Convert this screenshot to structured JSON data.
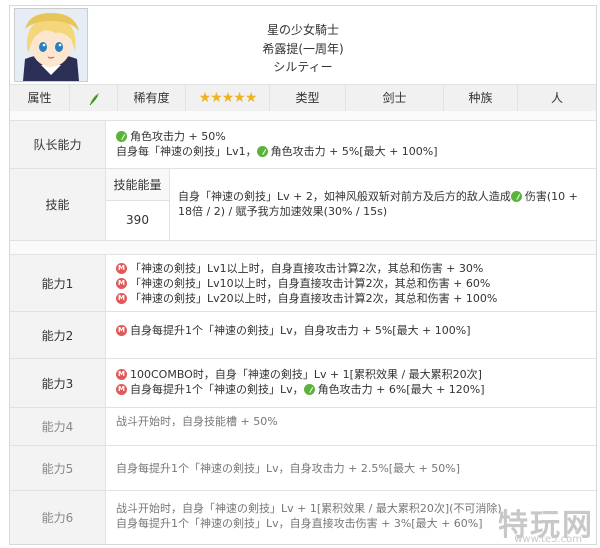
{
  "header": {
    "name_line1": "星の少女騎士",
    "name_line2": "希露提(一周年)",
    "name_line3": "シルティー"
  },
  "attributes": {
    "attr_label": "属性",
    "rarity_label": "稀有度",
    "rarity_stars": "★★★★★",
    "type_label": "类型",
    "type_value": "剑士",
    "race_label": "种族",
    "race_value": "人"
  },
  "leader": {
    "label": "队长能力",
    "line1": "角色攻击力 + 50%",
    "line2_pre": "自身每「神速の剣技」Lv1，",
    "line2_post": "角色攻击力 + 5%[最大 + 100%]"
  },
  "skill": {
    "label": "技能",
    "energy_label": "技能能量",
    "energy_value": "390",
    "desc_line1_pre": "自身「神速の剣技」Lv + 2，如神风般双斩对前方及后方的敌人造成",
    "desc_line1_post": "伤害(10 +",
    "desc_line2": "18倍 / 2) / 赋予我方加速效果(30% / 15s)"
  },
  "abilities": [
    {
      "label": "能力1",
      "lines": [
        "「神速の剣技」Lv1以上时，自身直接攻击计算2次，其总和伤害 + 30%",
        "「神速の剣技」Lv10以上时，自身直接攻击计算2次，其总和伤害 + 60%",
        "「神速の剣技」Lv20以上时，自身直接攻击计算2次，其总和伤害 + 100%"
      ]
    },
    {
      "label": "能力2",
      "lines": [
        "自身每提升1个「神速の剣技」Lv，自身攻击力 + 5%[最大 + 100%]"
      ]
    },
    {
      "label": "能力3",
      "line1": "100COMBO时，自身「神速の剣技」Lv + 1[累积效果 / 最大累积20次]",
      "line2_pre": "自身每提升1个「神速の剣技」Lv，",
      "line2_post": "角色攻击力 + 6%[最大 + 120%]"
    },
    {
      "label": "能力4",
      "line1": "战斗开始时，自身技能槽 + 50%"
    },
    {
      "label": "能力5",
      "line1": "自身每提升1个「神速の剣技」Lv，自身攻击力 + 2.5%[最大 + 50%]"
    },
    {
      "label": "能力6",
      "line1": "战斗开始时，自身「神速の剣技」Lv + 1[累积效果 / 最大累积20次](不可消除)",
      "line2": "自身每提升1个「神速の剣技」Lv，自身直接攻击伤害 + 3%[最大 + 60%]"
    }
  ],
  "watermark": {
    "text": "特玩网",
    "sub": "www.te5.com"
  },
  "colors": {
    "green_icon": "#5bb33b",
    "red_icon": "#e05a5a",
    "label_bg": "#f3f3f3"
  }
}
